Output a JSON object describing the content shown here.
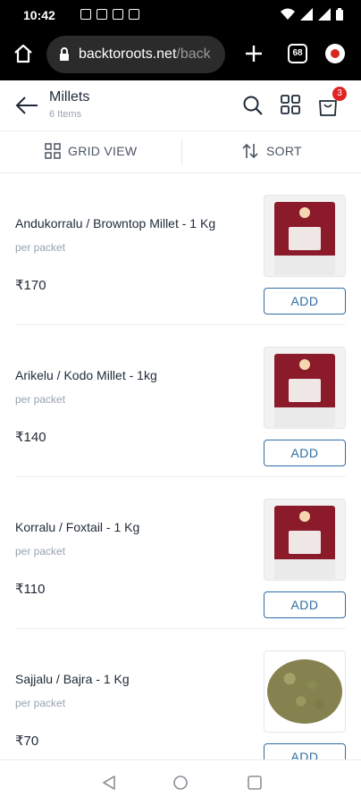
{
  "status": {
    "time": "10:42"
  },
  "browser": {
    "url_main": "backtoroots.net",
    "url_rest": "/back",
    "tab_count": "68"
  },
  "header": {
    "title": "Millets",
    "subtitle": "6 Items",
    "cart_count": "3"
  },
  "toolbar": {
    "grid_view_label": "GRID VIEW",
    "sort_label": "SORT"
  },
  "products": [
    {
      "name": "Andukorralu / Browntop Millet - 1 Kg",
      "unit": "per packet",
      "price": "₹170",
      "add_label": "ADD",
      "image": "red-packet"
    },
    {
      "name": "Arikelu / Kodo Millet - 1kg",
      "unit": "per packet",
      "price": "₹140",
      "add_label": "ADD",
      "image": "red-packet"
    },
    {
      "name": "Korralu / Foxtail - 1 Kg",
      "unit": "per packet",
      "price": "₹110",
      "add_label": "ADD",
      "image": "red-packet"
    },
    {
      "name": "Sajjalu / Bajra - 1 Kg",
      "unit": "per packet",
      "price": "₹70",
      "add_label": "ADD",
      "image": "seeds"
    }
  ],
  "colors": {
    "accent": "#2f6da3",
    "badge": "#e02424"
  },
  "icons": [
    "home-icon",
    "lock-icon",
    "plus-icon",
    "tabs-icon",
    "back-arrow-icon",
    "search-icon",
    "grid-icon",
    "cart-icon",
    "sort-icon",
    "nav-back-icon",
    "nav-home-icon",
    "nav-recents-icon"
  ]
}
